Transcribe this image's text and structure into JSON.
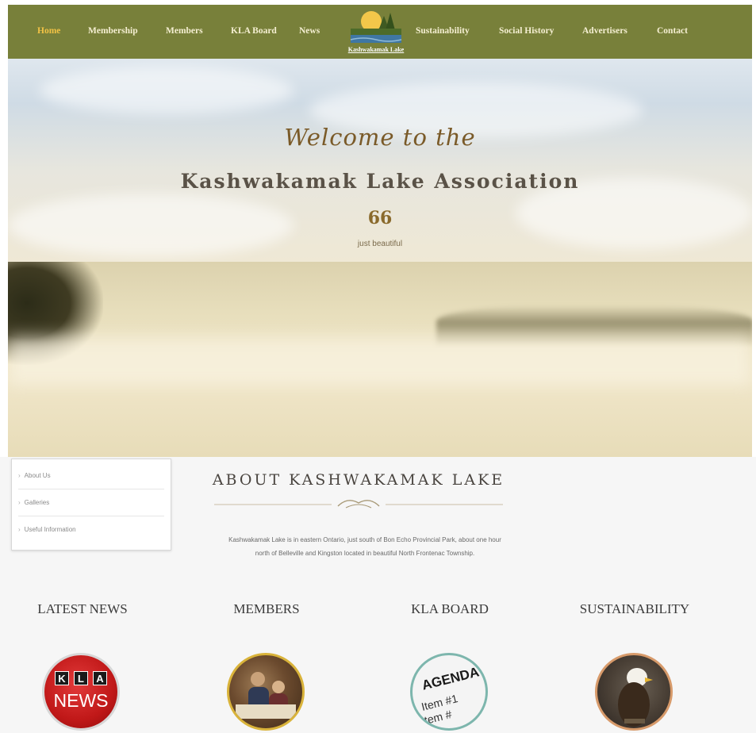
{
  "nav": {
    "items": [
      {
        "label": "Home",
        "active": true
      },
      {
        "label": "Membership"
      },
      {
        "label": "Members"
      },
      {
        "label": "KLA Board"
      },
      {
        "label": "News"
      },
      {
        "label": "Sustainability"
      },
      {
        "label": "Social History"
      },
      {
        "label": "Advertisers"
      },
      {
        "label": "Contact"
      }
    ],
    "logo_text": "Kashwakamak Lake"
  },
  "hero": {
    "script": "Welcome to the",
    "title": "Kashwakamak Lake Association",
    "quote_mark": "66",
    "tagline": "just beautiful"
  },
  "sidebar": {
    "items": [
      {
        "label": "About Us"
      },
      {
        "label": "Galleries"
      },
      {
        "label": "Useful Information"
      }
    ]
  },
  "about": {
    "title": "ABOUT KASHWAKAMAK LAKE",
    "line1": "Kashwakamak Lake is in eastern Ontario, just south of Bon Echo Provincial Park, about one hour",
    "line2": "north of Belleville and Kingston located in beautiful North Frontenac Township."
  },
  "features": [
    {
      "title": "LATEST NEWS",
      "image": "kla-news-logo",
      "kla_letters": [
        "K",
        "L",
        "A"
      ],
      "news_word": "NEWS"
    },
    {
      "title": "MEMBERS",
      "image": "members-photo"
    },
    {
      "title": "KLA BOARD",
      "image": "agenda-photo",
      "agenda_word": "AGENDA",
      "agenda_items": [
        "Item #1",
        "Item #"
      ]
    },
    {
      "title": "SUSTAINABILITY",
      "image": "eagle-photo"
    }
  ],
  "colors": {
    "nav_bg": "#78803a",
    "nav_active": "#f2c245",
    "hero_script": "#7a5a28",
    "accent_red": "#c01818"
  }
}
